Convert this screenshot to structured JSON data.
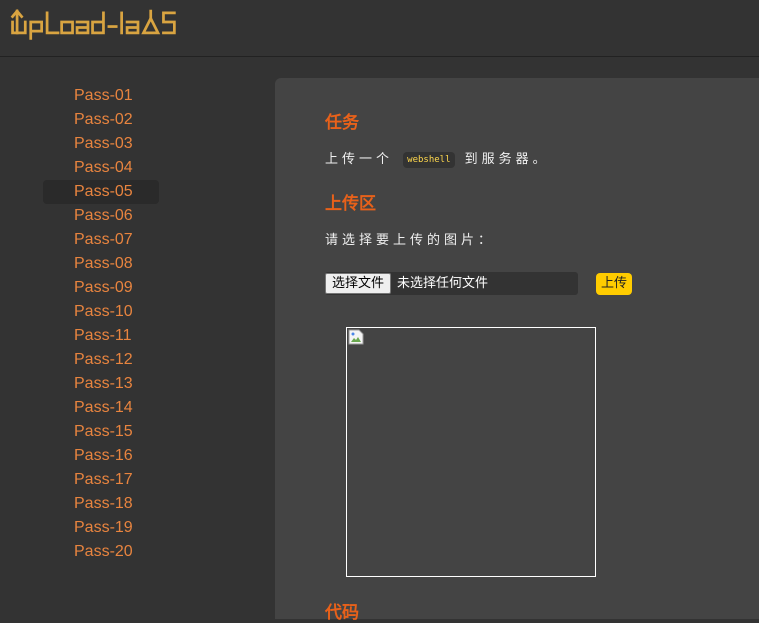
{
  "header": {
    "logo_text": "UpLoad-labS"
  },
  "sidebar": {
    "items": [
      {
        "label": "Pass-01"
      },
      {
        "label": "Pass-02"
      },
      {
        "label": "Pass-03"
      },
      {
        "label": "Pass-04"
      },
      {
        "label": "Pass-05",
        "active": true
      },
      {
        "label": "Pass-06"
      },
      {
        "label": "Pass-07"
      },
      {
        "label": "Pass-08"
      },
      {
        "label": "Pass-09"
      },
      {
        "label": "Pass-10"
      },
      {
        "label": "Pass-11"
      },
      {
        "label": "Pass-12"
      },
      {
        "label": "Pass-13"
      },
      {
        "label": "Pass-14"
      },
      {
        "label": "Pass-15"
      },
      {
        "label": "Pass-16"
      },
      {
        "label": "Pass-17"
      },
      {
        "label": "Pass-18"
      },
      {
        "label": "Pass-19"
      },
      {
        "label": "Pass-20"
      }
    ]
  },
  "main": {
    "task_title": "任务",
    "task_prefix": "上传一个",
    "task_code": "webshell",
    "task_suffix": "到服务器。",
    "upload_title": "上传区",
    "prompt": "请选择要上传的图片：",
    "file_button": "选择文件",
    "file_status": "未选择任何文件",
    "upload_button": "上传",
    "code_title": "代码"
  },
  "colors": {
    "accent_orange": "#e8611a",
    "nav_orange": "#e8843f",
    "logo_gold": "#d9a441",
    "button_yellow": "#ffcc00"
  },
  "icons": {
    "broken_image": "broken-image-icon"
  }
}
